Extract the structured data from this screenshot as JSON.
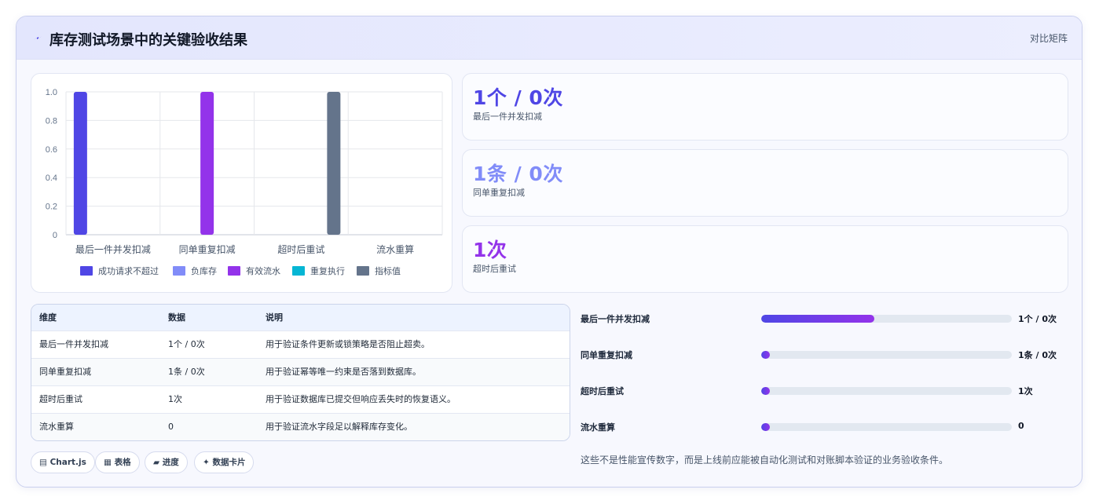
{
  "header": {
    "title": "库存测试场景中的关键验收结果",
    "action_label": "对比矩阵"
  },
  "chart_data": {
    "type": "bar",
    "categories": [
      "最后一件并发扣减",
      "同单重复扣减",
      "超时后重试",
      "流水重算"
    ],
    "series": [
      {
        "name": "成功请求不超过",
        "color": "#4f46e5",
        "values": [
          1,
          0,
          0,
          0
        ]
      },
      {
        "name": "负库存",
        "color": "#818cf8",
        "values": [
          0,
          0,
          0,
          0
        ]
      },
      {
        "name": "有效流水",
        "color": "#9333ea",
        "values": [
          0,
          1,
          0,
          0
        ]
      },
      {
        "name": "重复执行",
        "color": "#06b6d4",
        "values": [
          0,
          0,
          0,
          0
        ]
      },
      {
        "name": "指标值",
        "color": "#64748b",
        "values": [
          0,
          0,
          1,
          0
        ]
      }
    ],
    "ylim": [
      0,
      1
    ],
    "yticks": [
      "1.0",
      "0.8",
      "0.6",
      "0.4",
      "0.2",
      "0"
    ],
    "grid": true,
    "legend_position": "bottom"
  },
  "stats": [
    {
      "value": "1个 / 0次",
      "label": "最后一件并发扣减",
      "color": "#4f46e5"
    },
    {
      "value": "1条 / 0次",
      "label": "同单重复扣减",
      "color": "#818cf8"
    },
    {
      "value": "1次",
      "label": "超时后重试",
      "color": "#9333ea"
    }
  ],
  "table": {
    "headers": [
      "维度",
      "数据",
      "说明"
    ],
    "rows": [
      [
        "最后一件并发扣减",
        "1个 / 0次",
        "用于验证条件更新或锁策略是否阻止超卖。"
      ],
      [
        "同单重复扣减",
        "1条 / 0次",
        "用于验证幂等唯一约束是否落到数据库。"
      ],
      [
        "超时后重试",
        "1次",
        "用于验证数据库已提交但响应丢失时的恢复语义。"
      ],
      [
        "流水重算",
        "0",
        "用于验证流水字段足以解释库存变化。"
      ]
    ]
  },
  "pills": [
    "▤ Chart.js",
    "▦ 表格",
    "▰ 进度",
    "✦ 数据卡片"
  ],
  "progress": [
    {
      "label": "最后一件并发扣减",
      "value": "1个 / 0次",
      "fraction": 0.45
    },
    {
      "label": "同单重复扣减",
      "value": "1条 / 0次",
      "fraction": 0.03
    },
    {
      "label": "超时后重试",
      "value": "1次",
      "fraction": 0.03
    },
    {
      "label": "流水重算",
      "value": "0",
      "fraction": 0.03
    }
  ],
  "note": "这些不是性能宣传数字，而是上线前应能被自动化测试和对账脚本验证的业务验收条件。"
}
